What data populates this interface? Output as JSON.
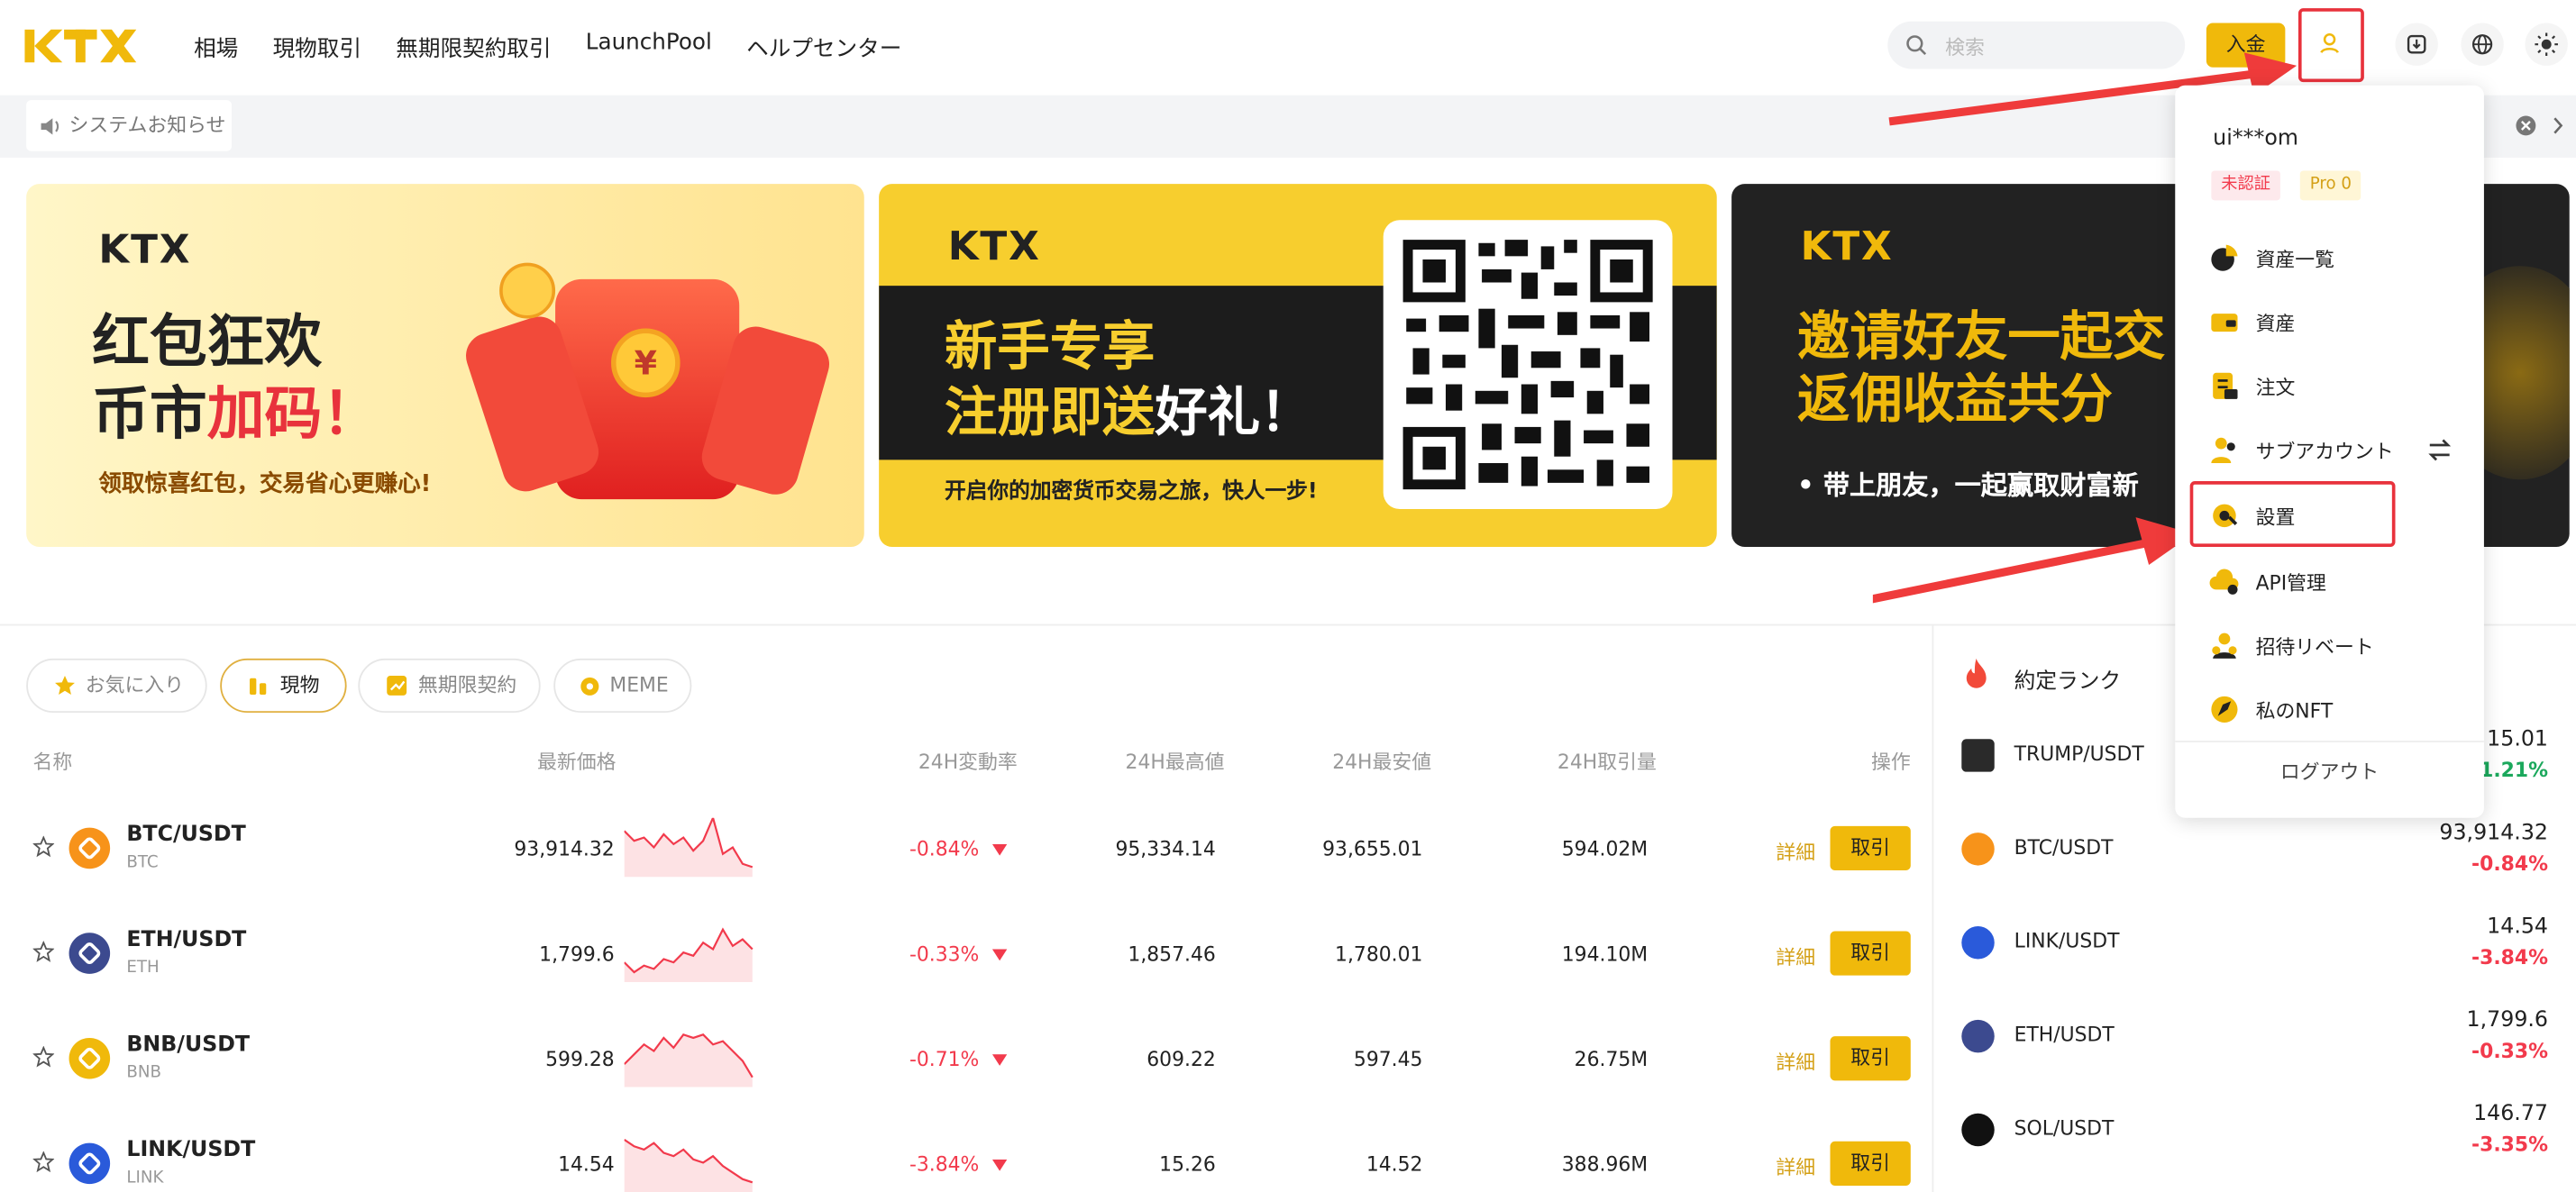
{
  "header": {
    "nav": [
      "相場",
      "現物取引",
      "無期限契約取引",
      "LaunchPool",
      "ヘルプセンター"
    ],
    "search_placeholder": "検索",
    "deposit": "入金"
  },
  "notice": {
    "label": "システムお知らせ"
  },
  "banners": [
    {
      "brand": "KTX",
      "line1": "红包狂欢",
      "line2a": "币市",
      "line2b": "加码！",
      "sub": "领取惊喜红包，交易省心更赚心!"
    },
    {
      "brand": "KTX",
      "line1": "新手专享",
      "line2a": "注册即送",
      "line2b": "好礼！",
      "sub": "开启你的加密货币交易之旅，快人一步!"
    },
    {
      "brand": "KTX",
      "line1": "邀请好友一起交",
      "line2": "返佣收益共分",
      "sub": "• 带上朋友，一起赢取财富新"
    }
  ],
  "market": {
    "tabs": [
      "お気に入り",
      "現物",
      "無期限契約",
      "MEME"
    ],
    "columns": [
      "名称",
      "最新価格",
      "24H変動率",
      "24H最高値",
      "24H最安値",
      "24H取引量",
      "操作"
    ],
    "detail_label": "詳細",
    "trade_label": "取引",
    "rows": [
      {
        "pair": "BTC/USDT",
        "base": "BTC",
        "price": "93,914.32",
        "change": "-0.84%",
        "high": "95,334.14",
        "low": "93,655.01",
        "volume": "594.02M",
        "color": "#f7931a"
      },
      {
        "pair": "ETH/USDT",
        "base": "ETH",
        "price": "1,799.6",
        "change": "-0.33%",
        "high": "1,857.46",
        "low": "1,780.01",
        "volume": "194.10M",
        "color": "#3c4a8f"
      },
      {
        "pair": "BNB/USDT",
        "base": "BNB",
        "price": "599.28",
        "change": "-0.71%",
        "high": "609.22",
        "low": "597.45",
        "volume": "26.75M",
        "color": "#f0b90b"
      },
      {
        "pair": "LINK/USDT",
        "base": "LINK",
        "price": "14.54",
        "change": "-3.84%",
        "high": "15.26",
        "low": "14.52",
        "volume": "388.96M",
        "color": "#2a5ada"
      }
    ]
  },
  "rank": {
    "title": "約定ランク",
    "rows": [
      {
        "pair": "TRUMP/USDT",
        "price": "15.01",
        "change": "+1.21%"
      },
      {
        "pair": "BTC/USDT",
        "price": "93,914.32",
        "change": "-0.84%"
      },
      {
        "pair": "LINK/USDT",
        "price": "14.54",
        "change": "-3.84%"
      },
      {
        "pair": "ETH/USDT",
        "price": "1,799.6",
        "change": "-0.33%"
      },
      {
        "pair": "SOL/USDT",
        "price": "146.77",
        "change": "-3.35%"
      }
    ]
  },
  "dropdown": {
    "user": "ui***om",
    "badge_unverified": "未認証",
    "badge_pro": "Pro 0",
    "items": [
      "資産一覧",
      "資産",
      "注文",
      "サブアカウント",
      "設置",
      "API管理",
      "招待リベート",
      "私のNFT"
    ],
    "logout": "ログアウト"
  }
}
